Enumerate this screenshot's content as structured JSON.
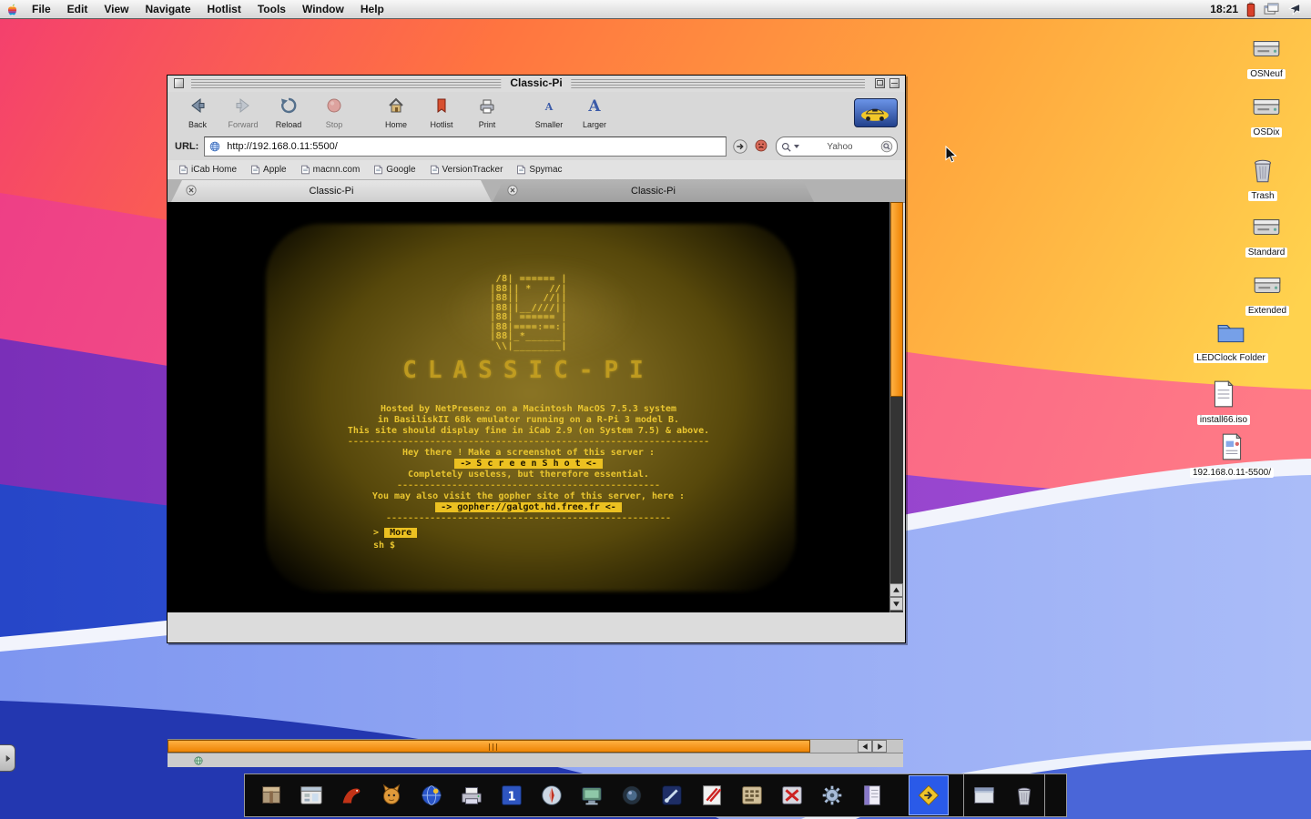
{
  "colors": {
    "scrollbar_orange": "#ee8404",
    "terminal_amber": "#e9c52f",
    "highlight_yellow": "#ecc121",
    "dock_selected_blue": "#2a5ae8"
  },
  "menu_bar": {
    "menus": [
      {
        "label": "File"
      },
      {
        "label": "Edit"
      },
      {
        "label": "View"
      },
      {
        "label": "Navigate"
      },
      {
        "label": "Hotlist"
      },
      {
        "label": "Tools"
      },
      {
        "label": "Window"
      },
      {
        "label": "Help"
      }
    ],
    "clock": "18:21"
  },
  "desktop": {
    "icons": [
      {
        "label": "OSNeuf",
        "kind": "drive"
      },
      {
        "label": "OSDix",
        "kind": "drive"
      },
      {
        "label": "Trash",
        "kind": "trash"
      },
      {
        "label": "Standard",
        "kind": "drive"
      },
      {
        "label": "Extended",
        "kind": "drive"
      },
      {
        "label": "LEDClock Folder",
        "kind": "folder"
      },
      {
        "label": "install66.iso",
        "kind": "document"
      },
      {
        "label": "192.168.0.11-5500/",
        "kind": "web-document"
      }
    ]
  },
  "window": {
    "title": "Classic-Pi",
    "toolbar": {
      "buttons": [
        {
          "label": "Back",
          "icon": "back-arrow",
          "disabled": false
        },
        {
          "label": "Forward",
          "icon": "forward-arrow",
          "disabled": true
        },
        {
          "label": "Reload",
          "icon": "reload",
          "disabled": false
        },
        {
          "label": "Stop",
          "icon": "stop",
          "disabled": true
        },
        {
          "label": "Home",
          "icon": "home",
          "disabled": false
        },
        {
          "label": "Hotlist",
          "icon": "hotlist",
          "disabled": false
        },
        {
          "label": "Print",
          "icon": "print",
          "disabled": false
        },
        {
          "label": "Smaller",
          "icon": "smaller-a",
          "disabled": false
        },
        {
          "label": "Larger",
          "icon": "larger-a",
          "disabled": false
        }
      ]
    },
    "url_bar": {
      "label": "URL:",
      "value": "http://192.168.0.11:5500/",
      "search_value": "Yahoo"
    },
    "bookmarks": [
      {
        "label": "iCab Home"
      },
      {
        "label": "Apple"
      },
      {
        "label": "macnn.com"
      },
      {
        "label": "Google"
      },
      {
        "label": "VersionTracker"
      },
      {
        "label": "Spymac"
      }
    ],
    "tabs": [
      {
        "label": "Classic-Pi",
        "active": true
      },
      {
        "label": "Classic-Pi",
        "active": false
      }
    ]
  },
  "terminal": {
    "ascii_logo": [
      " /8| ====== |",
      "|88|| *   //|",
      "|88||    //||",
      "|88||__////||",
      "|88| ====== |",
      "|88|====:==:|",
      "|88|_*______|",
      " \\\\|________|"
    ],
    "wordmark": "CLASSIC-PI",
    "lines": [
      {
        "type": "text",
        "text": "Hosted by NetPresenz on a Macintosh MacOS 7.5.3 system"
      },
      {
        "type": "text",
        "text": "in BasiliskII 68k emulator running on a R-Pi 3 model B."
      },
      {
        "type": "text",
        "text": "This site should display fine in iCab 2.9 (on System 7.5) & above."
      },
      {
        "type": "sep",
        "text": "------------------------------------------------------------------"
      },
      {
        "type": "text",
        "text": "Hey there ! Make a screenshot of this server :"
      },
      {
        "type": "highlight",
        "text": "-> S c r e e n S h o t <-"
      },
      {
        "type": "text",
        "text": "Completely useless, but therefore essential."
      },
      {
        "type": "sep",
        "text": "------------------------------------------------"
      },
      {
        "type": "text",
        "text": "You may also visit the gopher site of this server, here :"
      },
      {
        "type": "highlight",
        "text": "-> gopher://galgot.hd.free.fr <-"
      },
      {
        "type": "sep",
        "text": "----------------------------------------------------"
      }
    ],
    "more_prompt": {
      "prefix": ">",
      "button": "More"
    },
    "shell_prompt": "sh $"
  },
  "dock": {
    "items": [
      {
        "name": "stuffit-box",
        "group": "main"
      },
      {
        "name": "control-panels",
        "group": "main"
      },
      {
        "name": "dinosaur",
        "group": "main"
      },
      {
        "name": "cat",
        "group": "main"
      },
      {
        "name": "blue-globe",
        "group": "main"
      },
      {
        "name": "desktop-printer",
        "group": "main"
      },
      {
        "name": "blue-window-one",
        "group": "main"
      },
      {
        "name": "compass",
        "group": "main"
      },
      {
        "name": "monitor",
        "group": "main"
      },
      {
        "name": "dark-lens",
        "group": "main"
      },
      {
        "name": "blue-tool",
        "group": "main"
      },
      {
        "name": "red-strikes",
        "group": "main"
      },
      {
        "name": "keypad",
        "group": "main"
      },
      {
        "name": "red-x-transfer",
        "group": "main"
      },
      {
        "name": "gear",
        "group": "main"
      },
      {
        "name": "purple-notes",
        "group": "main"
      },
      {
        "name": "yellow-diamond-arrow",
        "group": "launcher",
        "selected": true
      },
      {
        "name": "app-window",
        "group": "system"
      },
      {
        "name": "trash-can",
        "group": "system"
      }
    ]
  }
}
